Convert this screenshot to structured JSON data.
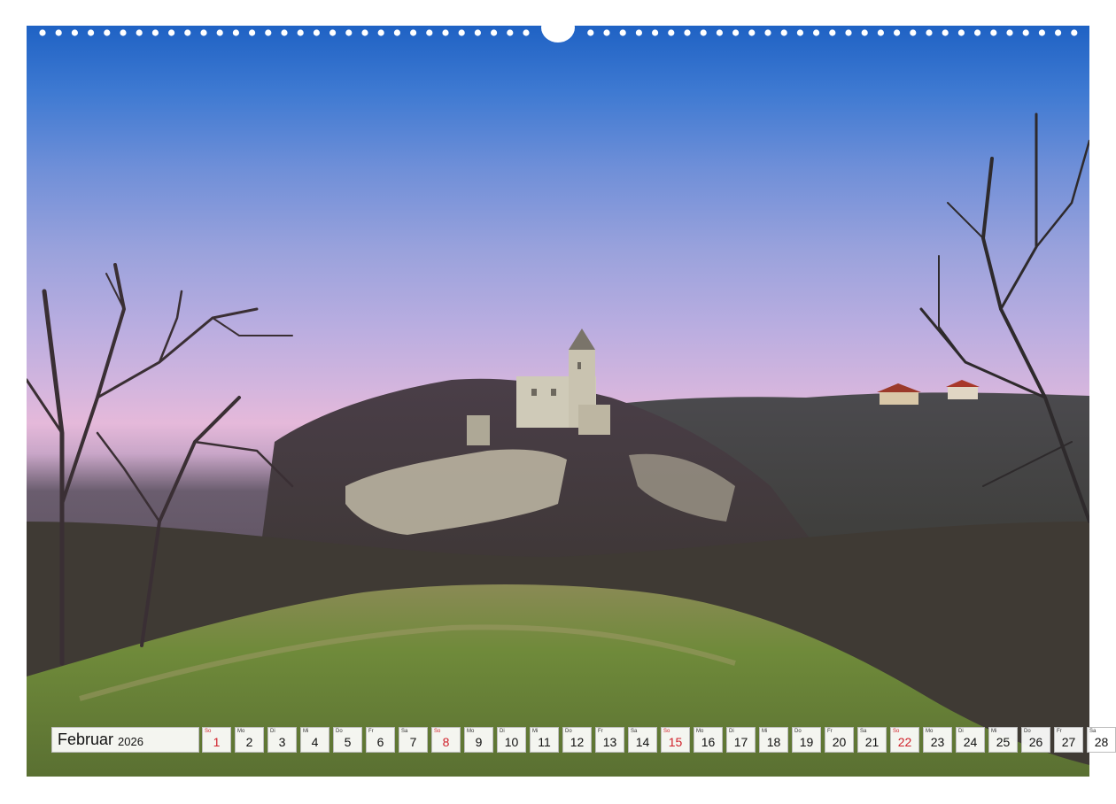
{
  "calendar": {
    "month": "Februar",
    "year": "2026",
    "days": [
      {
        "wd": "So",
        "num": "1",
        "sunday": true
      },
      {
        "wd": "Mo",
        "num": "2",
        "sunday": false
      },
      {
        "wd": "Di",
        "num": "3",
        "sunday": false
      },
      {
        "wd": "Mi",
        "num": "4",
        "sunday": false
      },
      {
        "wd": "Do",
        "num": "5",
        "sunday": false
      },
      {
        "wd": "Fr",
        "num": "6",
        "sunday": false
      },
      {
        "wd": "Sa",
        "num": "7",
        "sunday": false
      },
      {
        "wd": "So",
        "num": "8",
        "sunday": true
      },
      {
        "wd": "Mo",
        "num": "9",
        "sunday": false
      },
      {
        "wd": "Di",
        "num": "10",
        "sunday": false
      },
      {
        "wd": "Mi",
        "num": "11",
        "sunday": false
      },
      {
        "wd": "Do",
        "num": "12",
        "sunday": false
      },
      {
        "wd": "Fr",
        "num": "13",
        "sunday": false
      },
      {
        "wd": "Sa",
        "num": "14",
        "sunday": false
      },
      {
        "wd": "So",
        "num": "15",
        "sunday": true
      },
      {
        "wd": "Mo",
        "num": "16",
        "sunday": false
      },
      {
        "wd": "Di",
        "num": "17",
        "sunday": false
      },
      {
        "wd": "Mi",
        "num": "18",
        "sunday": false
      },
      {
        "wd": "Do",
        "num": "19",
        "sunday": false
      },
      {
        "wd": "Fr",
        "num": "20",
        "sunday": false
      },
      {
        "wd": "Sa",
        "num": "21",
        "sunday": false
      },
      {
        "wd": "So",
        "num": "22",
        "sunday": true
      },
      {
        "wd": "Mo",
        "num": "23",
        "sunday": false
      },
      {
        "wd": "Di",
        "num": "24",
        "sunday": false
      },
      {
        "wd": "Mi",
        "num": "25",
        "sunday": false
      },
      {
        "wd": "Do",
        "num": "26",
        "sunday": false
      },
      {
        "wd": "Fr",
        "num": "27",
        "sunday": false
      },
      {
        "wd": "Sa",
        "num": "28",
        "sunday": false
      }
    ]
  },
  "colors": {
    "sunday": "#d0202a",
    "sky_top": "#1f62c4",
    "sky_horizon": "#e5b9da",
    "grass": "#6f8a3a"
  },
  "photo": {
    "subject_icons": [
      "castle-icon",
      "binding-holes-icon"
    ]
  }
}
